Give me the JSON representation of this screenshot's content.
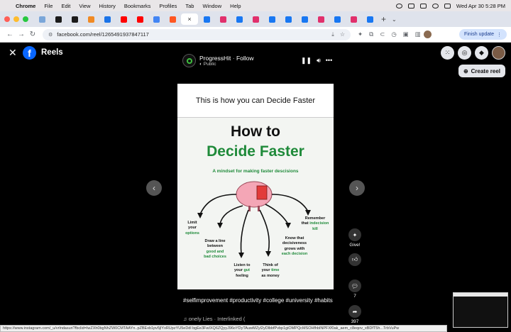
{
  "menubar": {
    "app": "Chrome",
    "items": [
      "File",
      "Edit",
      "View",
      "History",
      "Bookmarks",
      "Profiles",
      "Tab",
      "Window",
      "Help"
    ],
    "datetime": "Wed Apr 30  5:28 PM"
  },
  "tabs": [
    {
      "color": "#7aa6d9"
    },
    {
      "color": "#1b1b1b"
    },
    {
      "color": "#1b1b1b"
    },
    {
      "color": "#f08a24"
    },
    {
      "color": "#1a73e8"
    },
    {
      "color": "#ff0000"
    },
    {
      "color": "#ff0000"
    },
    {
      "color": "#4285f4"
    },
    {
      "color": "#ff5722"
    },
    {
      "active": true,
      "label": "×"
    },
    {
      "color": "#1877f2"
    },
    {
      "color": "#e1306c"
    },
    {
      "color": "#1877f2"
    },
    {
      "color": "#e1306c"
    },
    {
      "color": "#1877f2"
    },
    {
      "color": "#1877f2"
    },
    {
      "color": "#1877f2"
    },
    {
      "color": "#e1306c"
    },
    {
      "color": "#1877f2"
    },
    {
      "color": "#e1306c"
    },
    {
      "color": "#1877f2"
    }
  ],
  "address": {
    "url": "facebook.com/reel/1265491937847117",
    "update_label": "Finish update"
  },
  "header": {
    "title": "Reels",
    "create_label": "Create reel"
  },
  "poster": {
    "name": "ProgressHit",
    "follow": "Follow",
    "privacy": "Public"
  },
  "video": {
    "header_text": "This is how you can Decide Faster",
    "title_line1": "How to",
    "title_line2": "Decide Faster",
    "subtitle": "A mindset for making faster descisions",
    "tips": [
      {
        "lines": [
          "Limit",
          "your"
        ],
        "green": "options"
      },
      {
        "lines": [
          "Draw a line",
          "between"
        ],
        "green": "good and",
        "green2": "bad choices"
      },
      {
        "lines": [
          "Listen to",
          "your"
        ],
        "green": "gut",
        "tail": "feeling"
      },
      {
        "lines": [
          "Think of",
          "your"
        ],
        "green": "time",
        "tail": "as money"
      },
      {
        "lines": [
          "Know that",
          "decisiveness",
          "grows with"
        ],
        "green": "each decision"
      },
      {
        "lines": [
          "Remember",
          "that"
        ],
        "green": "indecision",
        "tail": "kill"
      }
    ]
  },
  "caption": {
    "hashtags": "#selfimprovement #productivity #college #university #habits",
    "music": "onely Lies · Interlinked ("
  },
  "actions": {
    "give": "Give!",
    "comments": "7",
    "shares": "397"
  },
  "statusbar": {
    "url": "https://www.instagram.com/_u/vrlndasuri?fbclid=IwZXh0bgNhZW0CMTAAYn..pZBExb1pv5jlYxRUpzYU5eDdl bgEe3FwIXQ6ZQyyJ96oYDyTAuwMZyl2yDlbbfPvbp1giOMPQcMSOHfhblNPFXf0ak_aem_c8eqov_xBDfT5h...TrbVuPw"
  }
}
